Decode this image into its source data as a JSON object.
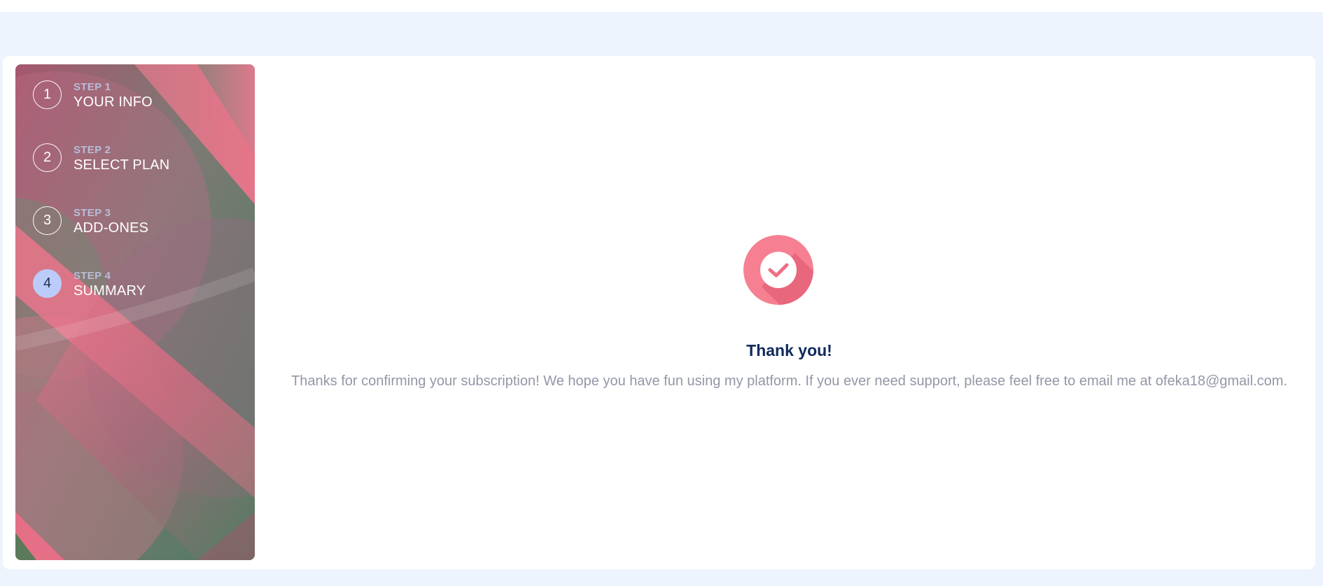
{
  "steps": [
    {
      "number": "1",
      "sub": "STEP 1",
      "title": "YOUR INFO",
      "active": false
    },
    {
      "number": "2",
      "sub": "STEP 2",
      "title": "SELECT PLAN",
      "active": false
    },
    {
      "number": "3",
      "sub": "STEP 3",
      "title": "ADD-ONES",
      "active": false
    },
    {
      "number": "4",
      "sub": "STEP 4",
      "title": "SUMMARY",
      "active": true
    }
  ],
  "confirmation": {
    "icon": "checkmark-icon",
    "title": "Thank you!",
    "message": "Thanks for confirming your subscription! We hope you have fun using my platform. If you ever need support, please feel free to email me at ofeka18@gmail.com."
  },
  "colors": {
    "page_background": "#eef4fe",
    "card_background": "#ffffff",
    "sidebar_pink": "#e8758a",
    "sidebar_green": "#3f7a62",
    "active_step": "#bcccfa",
    "check_circle": "#f67f91",
    "title_color": "#0f2a5c",
    "message_color": "#9397a6"
  }
}
